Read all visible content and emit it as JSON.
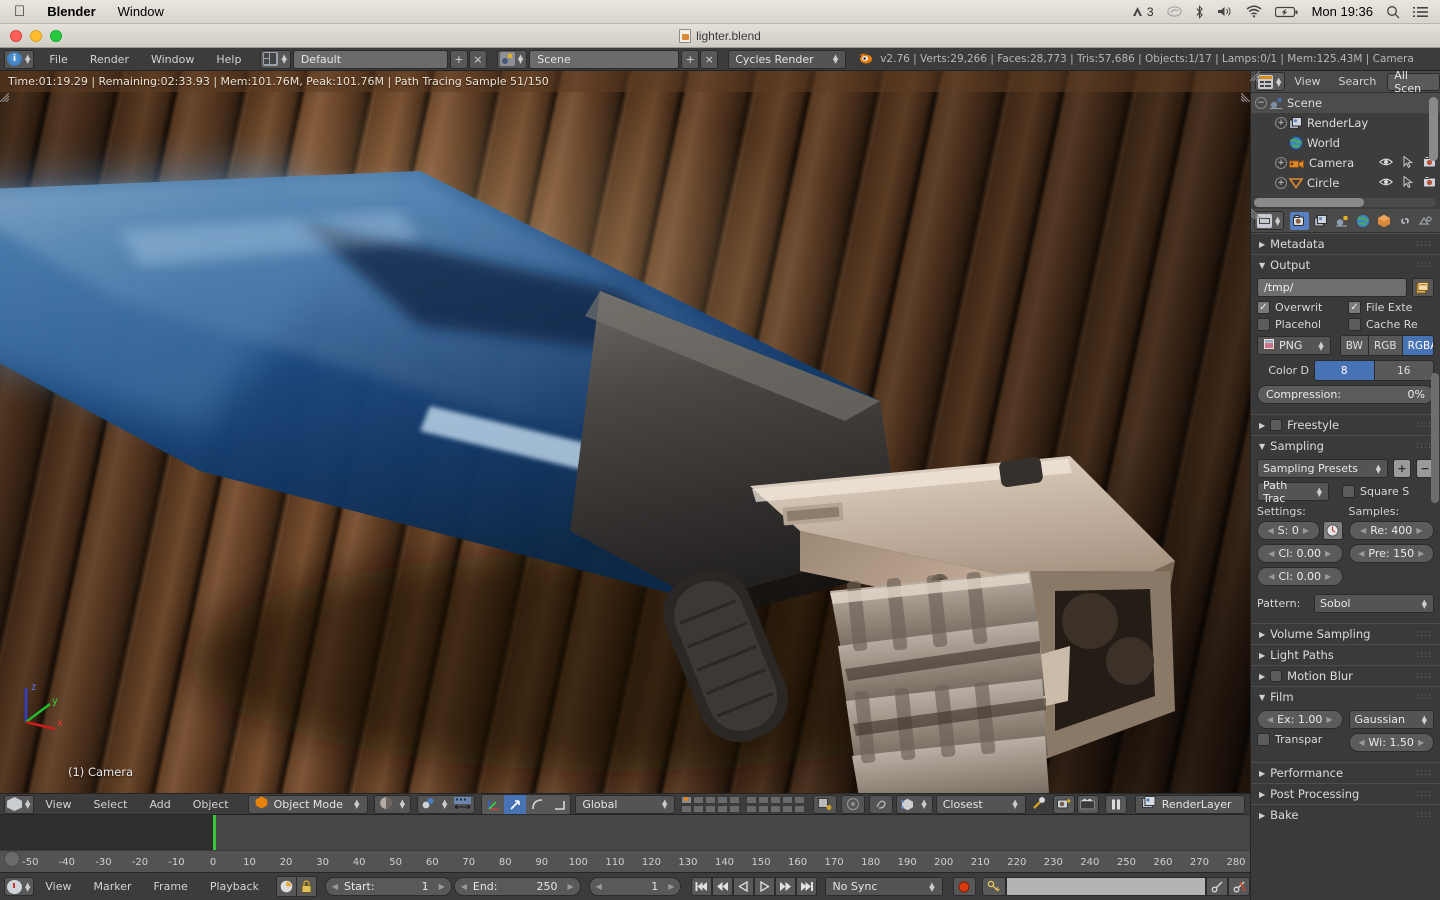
{
  "macos": {
    "apple_menu": "",
    "menus": [
      "Blender",
      "Window"
    ],
    "status_items": [
      "adobe-cc-icon",
      "bluetooth-icon",
      "volume-icon",
      "wifi-icon",
      "battery-icon"
    ],
    "adobe_count": "3",
    "clock": "Mon 19:36",
    "search_icon": "search-icon",
    "notification_icon": "list-icon"
  },
  "window": {
    "title": "lighter.blend"
  },
  "header": {
    "editor_type": "info-editor-icon",
    "menus": [
      "File",
      "Render",
      "Window",
      "Help"
    ],
    "screen_layout": "Default",
    "scene_name": "Scene",
    "engine": "Cycles Render",
    "add_label": "+",
    "remove_label": "×",
    "stats": "v2.76 | Verts:29,266 | Faces:28,773 | Tris:57,686 | Objects:1/17 | Lamps:0/1 | Mem:125.43M | Camera"
  },
  "render_progress": {
    "text": "Time:01:19.29 | Remaining:02:33.93 | Mem:101.76M, Peak:101.76M | Path Tracing Sample 51/150"
  },
  "viewport": {
    "camera_label": "(1) Camera",
    "axis_x": "x",
    "axis_y": "y",
    "axis_z": "z"
  },
  "viewport_footer": {
    "editor_type": "3d-view-icon",
    "menus": [
      "View",
      "Select",
      "Add",
      "Object"
    ],
    "mode": "Object Mode",
    "shading": "solid-shading-icon",
    "pivot": "pivot-icon",
    "transform_orientation": "Global",
    "snap_mode": "Closest",
    "render_layer": "RenderLayer"
  },
  "timeline": {
    "editor_type": "timeline-icon",
    "menus": [
      "View",
      "Marker",
      "Frame",
      "Playback"
    ],
    "start_label": "Start:",
    "start_value": "1",
    "end_label": "End:",
    "end_value": "250",
    "current_frame": "1",
    "sync_mode": "No Sync",
    "ticks": [
      "-50",
      "-40",
      "-30",
      "-20",
      "-10",
      "0",
      "10",
      "20",
      "30",
      "40",
      "50",
      "60",
      "70",
      "80",
      "90",
      "100",
      "110",
      "120",
      "130",
      "140",
      "150",
      "160",
      "170",
      "180",
      "190",
      "200",
      "210",
      "220",
      "230",
      "240",
      "250",
      "260",
      "270",
      "280"
    ],
    "playhead_frame": "0",
    "transport": [
      "jump-start-icon",
      "prev-keyframe-icon",
      "play-reverse-icon",
      "play-icon",
      "next-keyframe-icon",
      "jump-end-icon"
    ],
    "record_icon": "record-icon",
    "auto_key_icon": "keyframe-icon"
  },
  "outliner": {
    "editor_type": "outliner-icon",
    "menus": [
      "View",
      "Search"
    ],
    "display_mode": "All Scen",
    "rows": [
      {
        "label": "Scene",
        "icon": "scene-icon",
        "indent": 0,
        "expander": "−",
        "selected": true,
        "has_toggles": false
      },
      {
        "label": "RenderLay",
        "icon": "renderlayer-icon",
        "indent": 1,
        "expander": "+",
        "selected": false,
        "has_toggles": false
      },
      {
        "label": "World",
        "icon": "world-icon",
        "indent": 1,
        "expander": "",
        "selected": false,
        "has_toggles": false
      },
      {
        "label": "Camera",
        "icon": "camera-icon",
        "indent": 1,
        "expander": "+",
        "selected": false,
        "has_toggles": true
      },
      {
        "label": "Circle",
        "icon": "mesh-icon",
        "indent": 1,
        "expander": "+",
        "selected": false,
        "has_toggles": true
      }
    ]
  },
  "properties": {
    "tabs": [
      "render-tab-icon",
      "renderlayers-tab-icon",
      "scene-tab-icon",
      "world-tab-icon",
      "object-tab-icon",
      "constraints-tab-icon",
      "modifiers-tab-icon"
    ],
    "active_tab_index": 0,
    "panels": [
      {
        "title": "Metadata",
        "open": false
      },
      {
        "title": "Output",
        "open": true
      },
      {
        "title": "Freestyle",
        "open": false,
        "checkbox": false
      },
      {
        "title": "Sampling",
        "open": true
      },
      {
        "title": "Volume Sampling",
        "open": false
      },
      {
        "title": "Light Paths",
        "open": false
      },
      {
        "title": "Motion Blur",
        "open": false,
        "checkbox": false
      },
      {
        "title": "Film",
        "open": true
      },
      {
        "title": "Performance",
        "open": false
      },
      {
        "title": "Post Processing",
        "open": false
      },
      {
        "title": "Bake",
        "open": false
      }
    ],
    "output": {
      "path": "/tmp/",
      "folder_icon": "folder-icon",
      "overwrite_label": "Overwrit",
      "overwrite_checked": true,
      "file_extensions_label": "File Exte",
      "file_extensions_checked": true,
      "placeholders_label": "Placehol",
      "placeholders_checked": false,
      "cache_label": "Cache Re",
      "cache_checked": false,
      "file_format": "PNG",
      "file_format_icon": "image-file-icon",
      "color_modes": [
        "BW",
        "RGB",
        "RGBA"
      ],
      "color_mode_selected": "RGBA",
      "color_depth_label": "Color D",
      "color_depths": [
        "8",
        "16"
      ],
      "color_depth_selected": "8",
      "compression_label": "Compression:",
      "compression_value": "0%"
    },
    "sampling": {
      "presets_label": "Sampling Presets",
      "preset_add": "+",
      "preset_remove": "−",
      "integrator": "Path Trac",
      "square_samples_label": "Square S",
      "square_samples_checked": false,
      "settings_label": "Settings:",
      "samples_label": "Samples:",
      "seed_label": "S: 0",
      "seed_animate_icon": "clock-icon",
      "clamp_direct_label": "Cl: 0.00",
      "clamp_indirect_label": "Cl: 0.00",
      "render_samples_label": "Re: 400",
      "preview_samples_label": "Pre: 150",
      "pattern_label": "Pattern:",
      "pattern_value": "Sobol"
    },
    "film": {
      "exposure_label": "Ex: 1.00",
      "transparent_label": "Transpar",
      "transparent_checked": false,
      "filter_type": "Gaussian",
      "filter_width_label": "Wi: 1.50"
    }
  },
  "colors": {
    "accent_blue": "#4772b3",
    "header_bg": "#3c3c3c",
    "panel_bg": "#3a3a3a",
    "playhead_green": "#3ec53e",
    "record_red": "#d83c10"
  }
}
